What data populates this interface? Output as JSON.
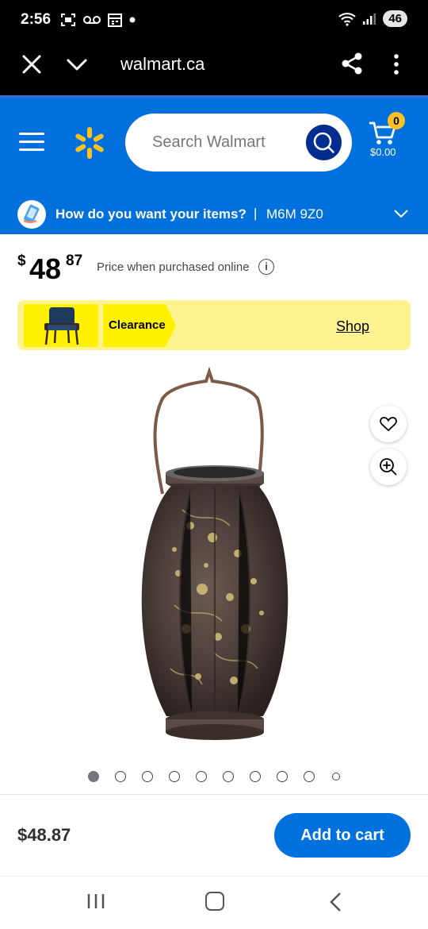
{
  "status_bar": {
    "time": "2:56",
    "battery": "46",
    "icons": [
      "screenshot-icon",
      "voicemail-icon",
      "calendar-icon",
      "dot-icon",
      "wifi-icon",
      "signal-icon"
    ]
  },
  "browser": {
    "url": "walmart.ca",
    "icons": [
      "close-icon",
      "chevron-down-icon",
      "share-icon",
      "more-vert-icon"
    ]
  },
  "header": {
    "search_placeholder": "Search Walmart",
    "cart_count": "0",
    "cart_amount": "$0.00",
    "brand_color": "#0071dc",
    "spark_color": "#ffc220"
  },
  "delivery": {
    "prompt": "How do you want your items?",
    "separator": "|",
    "postal_code": "M6M 9Z0"
  },
  "price": {
    "currency": "$",
    "dollars": "48",
    "cents": "87",
    "note": "Price when purchased online",
    "info": "i"
  },
  "banner": {
    "tag": "Clearance",
    "link": "Shop",
    "color": "#fff291"
  },
  "gallery": {
    "dot_count": 10,
    "active_index": 0
  },
  "footer": {
    "price": "$48.87",
    "add_to_cart": "Add to cart"
  }
}
